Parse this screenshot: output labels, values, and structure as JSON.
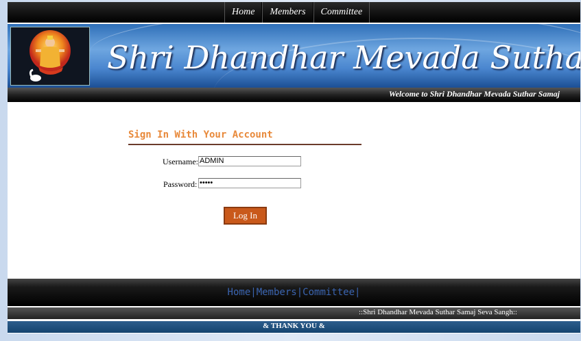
{
  "top_nav": [
    "Home",
    "Members",
    "Committee"
  ],
  "banner": {
    "title": "Shri Dhandhar Mevada Suthar Samaj",
    "welcome": "Welcome to Shri Dhandhar Mevada Suthar Samaj"
  },
  "login": {
    "title": "Sign In With Your Account",
    "username_label": "Username:",
    "username_value": "ADMIN",
    "password_label": "Password:",
    "password_value": "•••••",
    "button": "Log In"
  },
  "footer": {
    "links": [
      "Home",
      "Members",
      "Committee"
    ],
    "separator": "|",
    "sangh": "::Shri Dhandhar Mevada Suthar Samaj Seva Sangh::",
    "thanks": "& THANK YOU &"
  },
  "colors": {
    "accent": "#e8893a",
    "button": "#c9591b",
    "link": "#3a64b0"
  }
}
